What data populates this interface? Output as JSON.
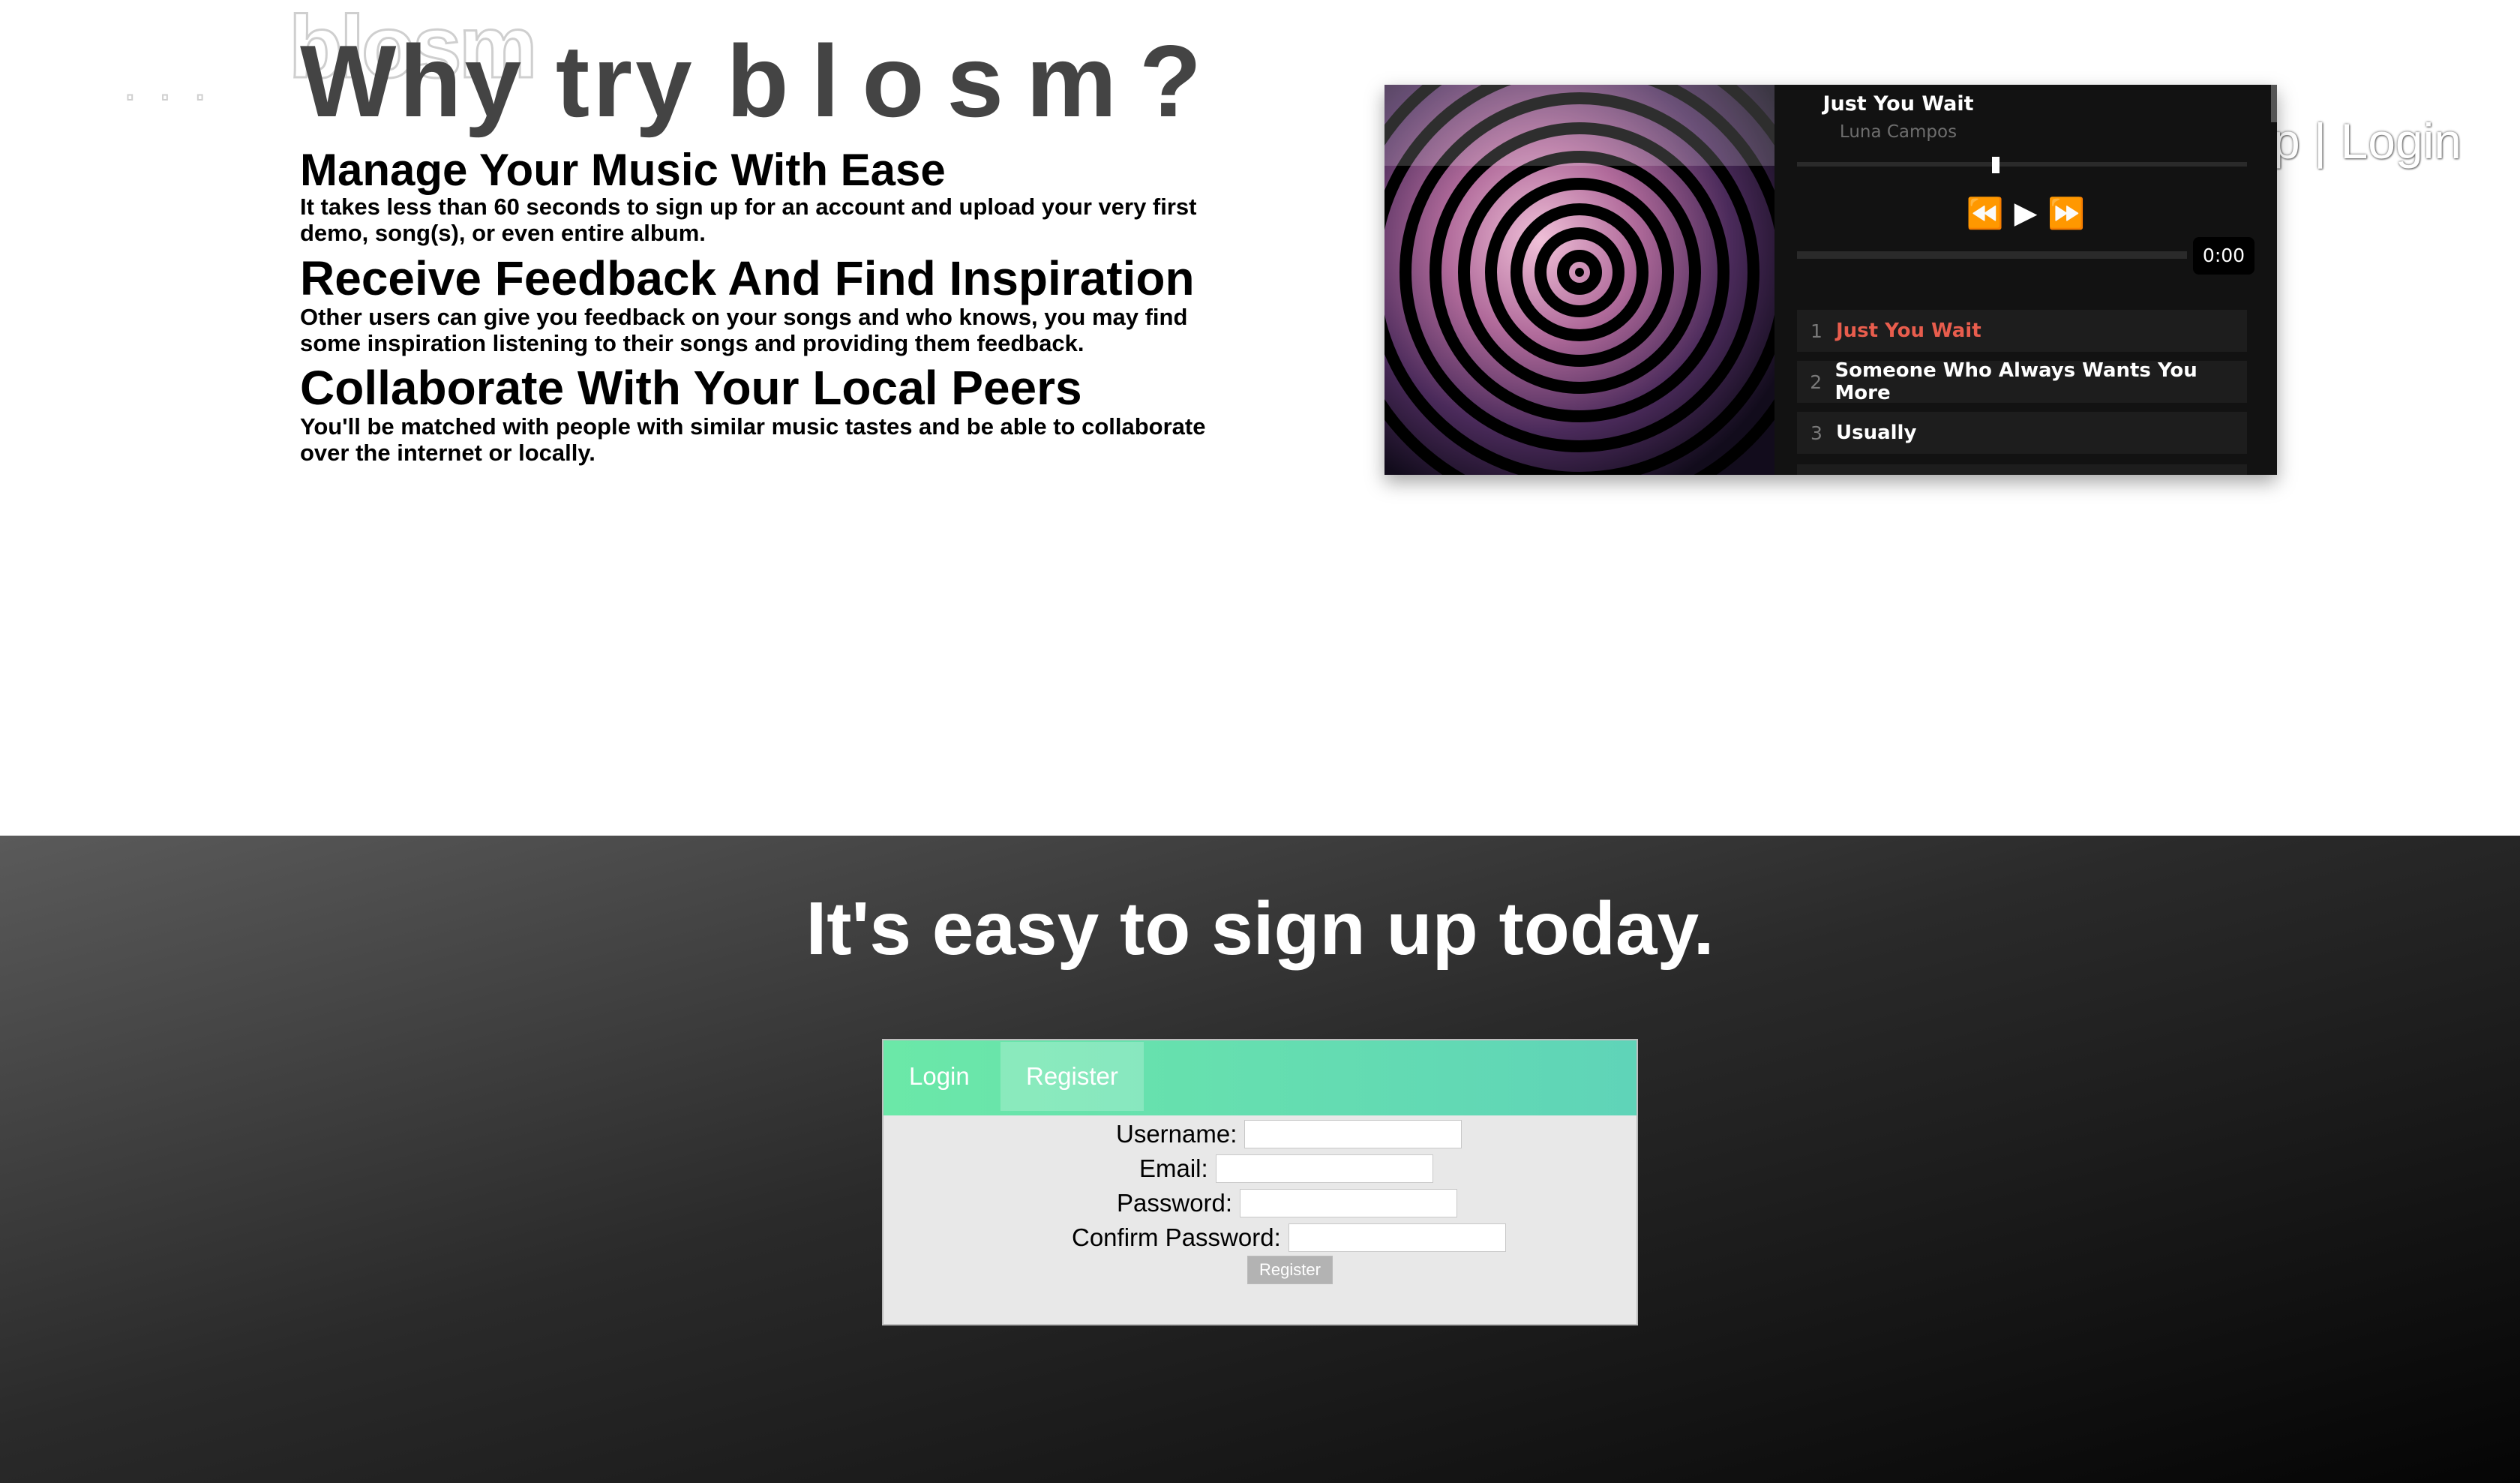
{
  "header": {
    "logo": "blosm",
    "nav_text": "p | Login"
  },
  "why": {
    "title_prefix": "Why try ",
    "title_brand": "blosm?",
    "features": [
      {
        "title": "Manage Your Music With Ease",
        "text": "It takes less than 60 seconds to sign up for an account and upload your very first demo, song(s), or even entire album."
      },
      {
        "title": "Receive Feedback And Find Inspiration",
        "text": "Other users can give you feedback on your songs and who knows, you may find some inspiration listening to their songs and providing them feedback."
      },
      {
        "title": "Collaborate With Your Local Peers",
        "text": "You'll be matched with people with similar music tastes and be able to collaborate over the internet or locally."
      }
    ]
  },
  "player": {
    "track_title": "Just You Wait",
    "artist": "Luna Campos",
    "progress": 0.5,
    "time": "0:00",
    "controls": {
      "prev": "⏪",
      "play": "▶",
      "next": "⏩"
    },
    "playlist": [
      {
        "num": "1",
        "name": "Just You Wait",
        "active": true
      },
      {
        "num": "2",
        "name": "Someone Who Always Wants You More",
        "active": false
      },
      {
        "num": "3",
        "name": "Usually",
        "active": false
      }
    ],
    "colors": {
      "active": "#e85d4d",
      "background": "#121212"
    }
  },
  "signup": {
    "heading": "It's easy to sign up today.",
    "tabs": {
      "login": "Login",
      "register": "Register"
    },
    "fields": {
      "username": "Username:",
      "email": "Email:",
      "password": "Password:",
      "confirm": "Confirm Password:"
    },
    "submit": "Register",
    "colors": {
      "tab_start": "#6be8a8",
      "tab_end": "#5fd4b8"
    }
  }
}
